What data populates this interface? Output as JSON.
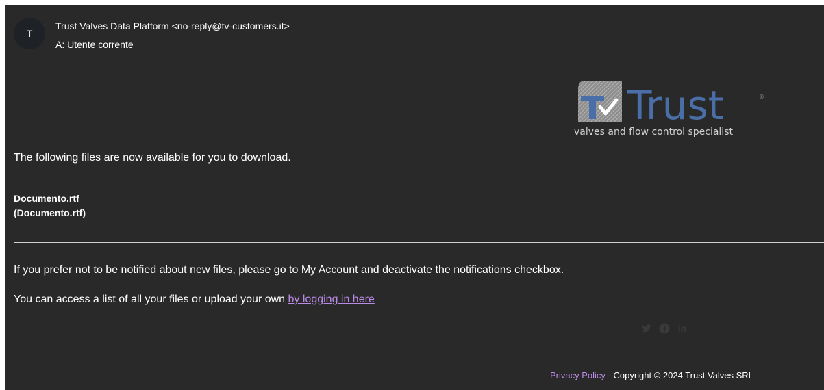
{
  "sender": {
    "avatar_letter": "T",
    "from": "Trust Valves Data Platform <no-reply@tv-customers.it>",
    "to_label": "A:",
    "to_value": "Utente corrente"
  },
  "logo": {
    "brand": "Trust",
    "tagline": "valves and flow control specialist",
    "accent_color": "#4a6fa8"
  },
  "body": {
    "intro": "The following files are now available for you to download.",
    "files": [
      {
        "name": "Documento.rtf",
        "filename": "(Documento.rtf)"
      }
    ],
    "notify_text": "If you prefer not to be notified about new files, please go to My Account and deactivate the notifications checkbox.",
    "access_text": "You can access a list of all your files or upload your own ",
    "access_link": "by logging in here"
  },
  "social": [
    "twitter-icon",
    "facebook-icon",
    "linkedin-icon"
  ],
  "footer": {
    "privacy": "Privacy Policy",
    "separator": " - ",
    "copyright": "Copyright © 2024 Trust Valves SRL"
  }
}
